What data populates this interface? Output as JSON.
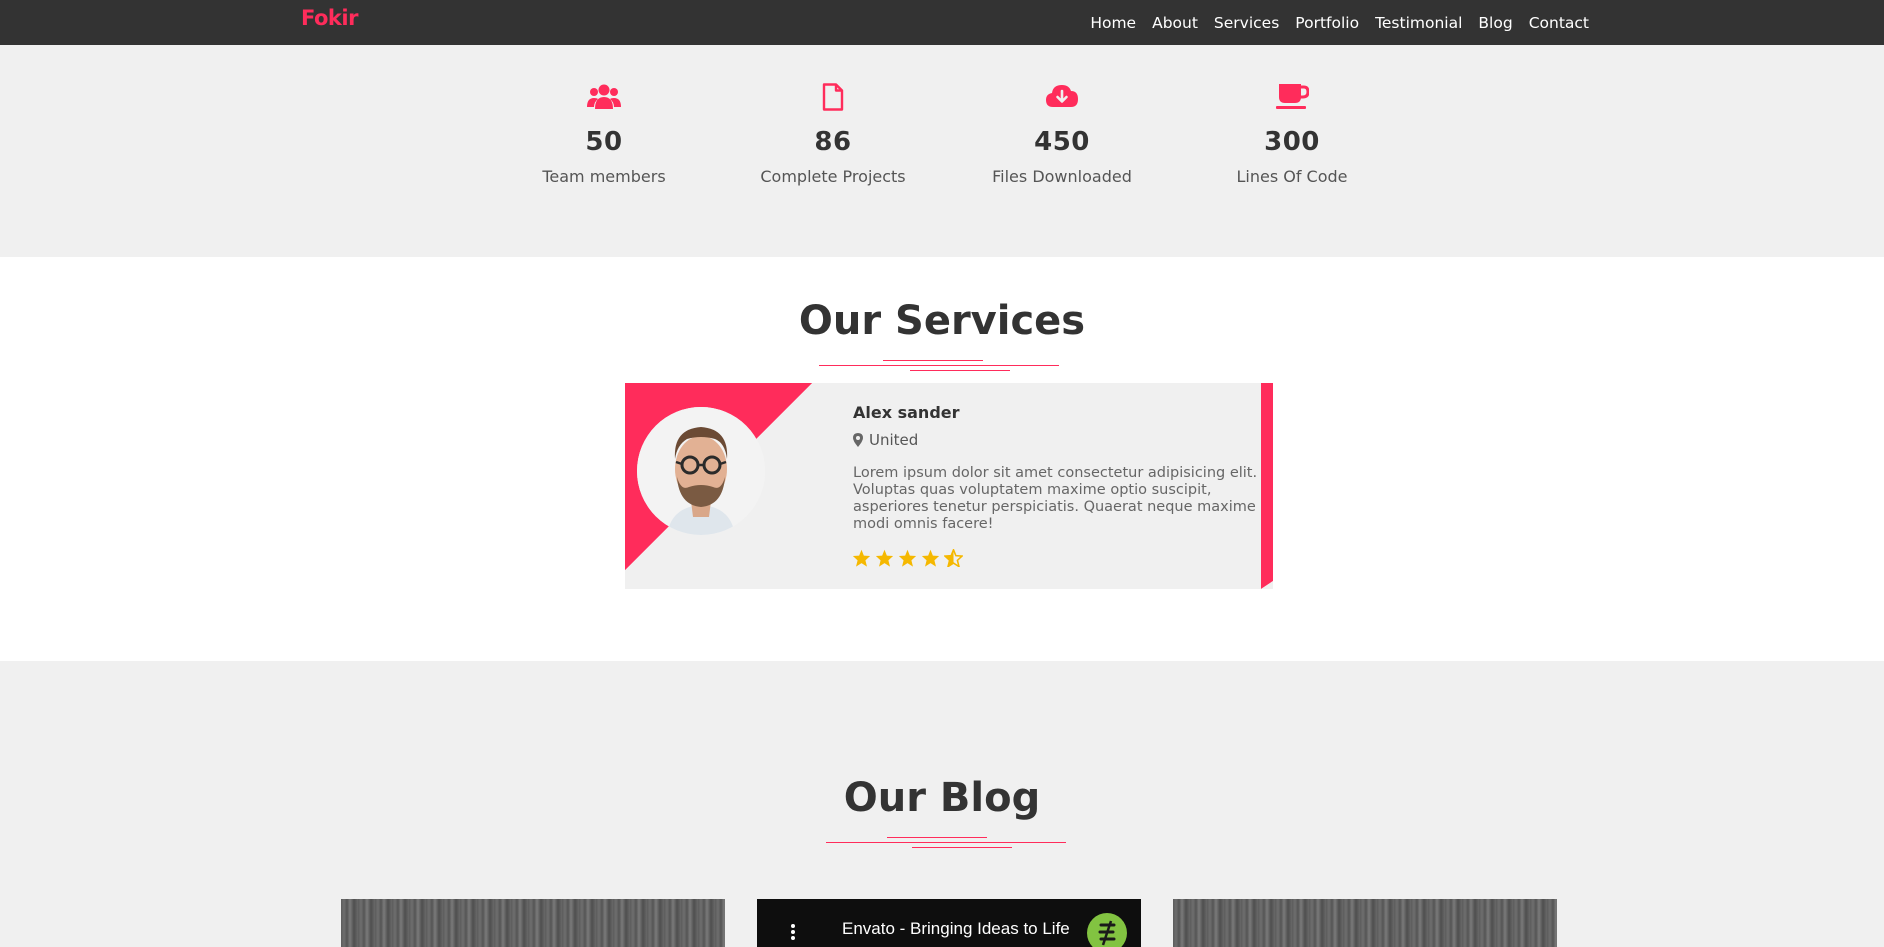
{
  "brand": "Fokir",
  "nav": [
    "Home",
    "About",
    "Services",
    "Portfolio",
    "Testimonial",
    "Blog",
    "Contact"
  ],
  "counters": [
    {
      "icon": "users-icon",
      "value": "50",
      "label": "Team members"
    },
    {
      "icon": "file-icon",
      "value": "86",
      "label": "Complete Projects"
    },
    {
      "icon": "cloud-download-icon",
      "value": "450",
      "label": "Files Downloaded"
    },
    {
      "icon": "coffee-cup-icon",
      "value": "300",
      "label": "Lines Of Code"
    }
  ],
  "services": {
    "title": "Our Services",
    "card": {
      "name": "Alex sander",
      "location": "United",
      "description": "Lorem ipsum dolor sit amet consectetur adipisicing elit. Voluptas quas voluptatem maxime optio suscipit, asperiores tenetur perspiciatis. Quaerat neque maxime modi omnis facere!",
      "rating": 4.5
    }
  },
  "blog": {
    "title": "Our Blog",
    "video_title": "Envato - Bringing Ideas to Life"
  },
  "colors": {
    "accent": "#ff2c5b",
    "navbar": "#333333",
    "star": "#f5b800"
  }
}
